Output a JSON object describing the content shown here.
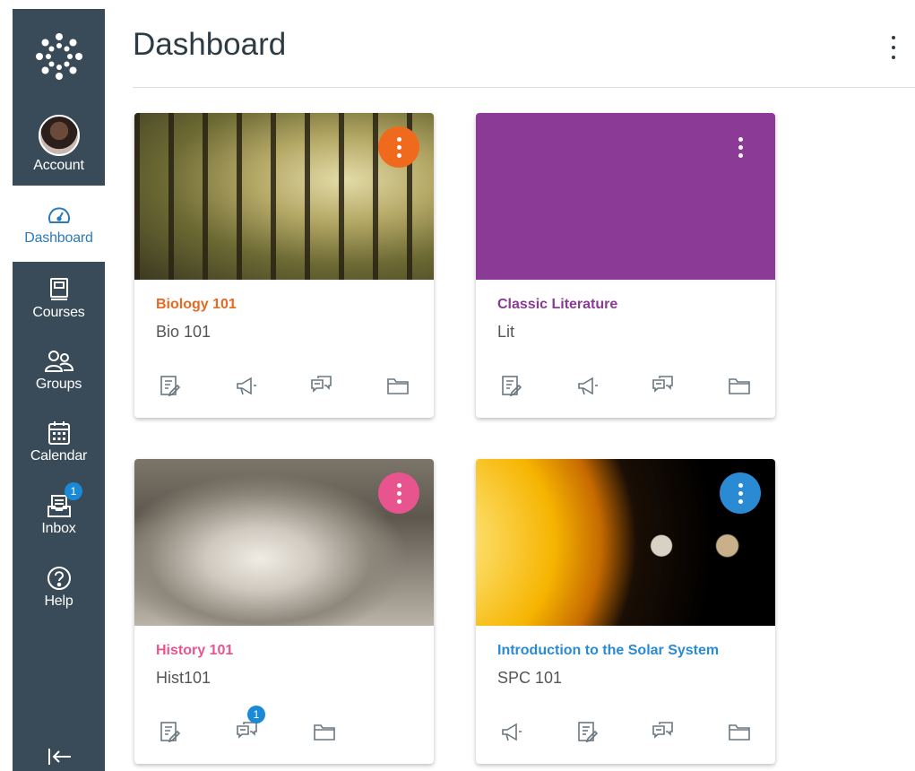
{
  "sidebar": {
    "items": [
      {
        "label": "Account",
        "icon": "avatar"
      },
      {
        "label": "Dashboard",
        "icon": "dashboard-icon"
      },
      {
        "label": "Courses",
        "icon": "courses-icon"
      },
      {
        "label": "Groups",
        "icon": "groups-icon"
      },
      {
        "label": "Calendar",
        "icon": "calendar-icon"
      },
      {
        "label": "Inbox",
        "icon": "inbox-icon",
        "badge": "1"
      },
      {
        "label": "Help",
        "icon": "help-icon"
      }
    ],
    "collapse_icon": "collapse-icon",
    "colors": {
      "background": "#394b58",
      "active_background": "#ffffff",
      "active_text": "#2b7abc"
    }
  },
  "header": {
    "title": "Dashboard",
    "menu_icon": "kebab-icon"
  },
  "cards": [
    {
      "title": "Biology 101",
      "subtitle": "Bio 101",
      "color": "#e66a23",
      "image": "forest",
      "actions": [
        "assignments-icon",
        "announcements-icon",
        "discussions-icon",
        "files-icon"
      ]
    },
    {
      "title": "Classic Literature",
      "subtitle": "Lit",
      "color": "#8b3a96",
      "image": "solid-purple",
      "actions": [
        "assignments-icon",
        "announcements-icon",
        "discussions-icon",
        "files-icon"
      ]
    },
    {
      "title": "History 101",
      "subtitle": "Hist101",
      "color": "#e8548e",
      "image": "lincoln-memorial",
      "actions": [
        "assignments-icon",
        "discussions-icon",
        "files-icon"
      ],
      "discussion_badge": "1"
    },
    {
      "title": "Introduction to the Solar System",
      "subtitle": "SPC 101",
      "color": "#2b8ad4",
      "image": "solar-system",
      "actions": [
        "announcements-icon",
        "assignments-icon",
        "discussions-icon",
        "files-icon"
      ]
    }
  ]
}
